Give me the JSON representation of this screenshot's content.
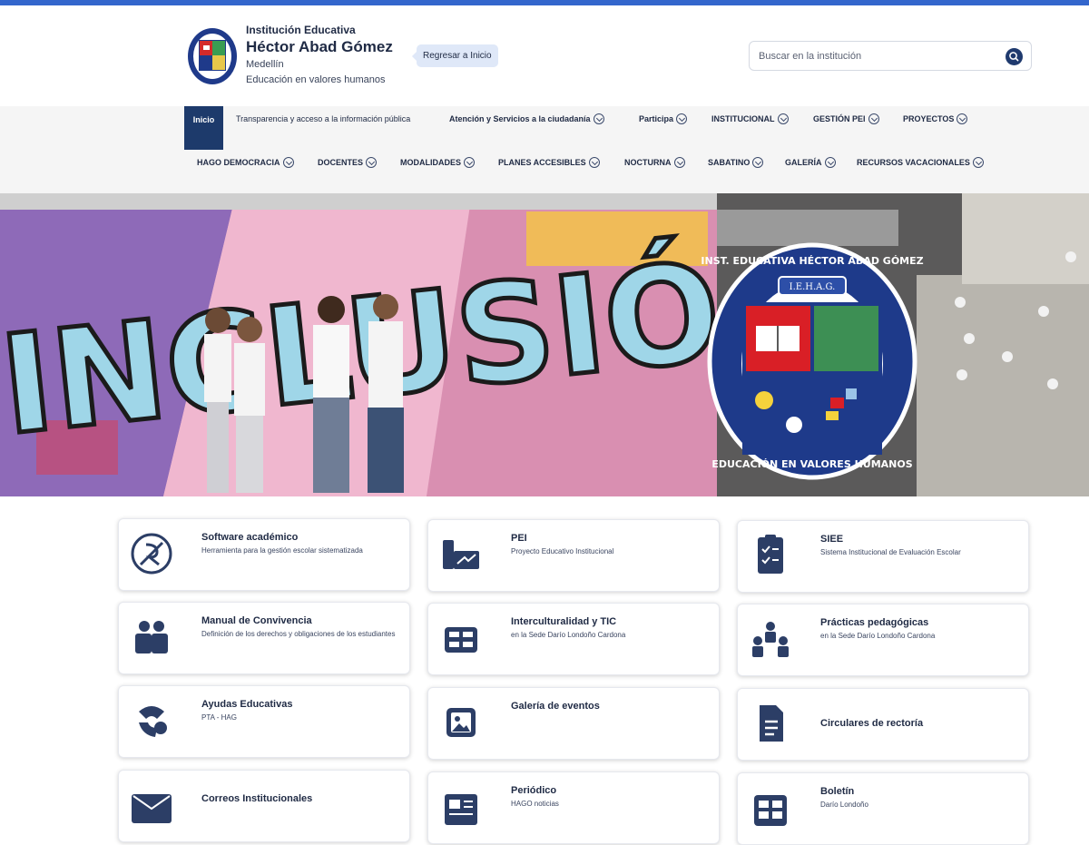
{
  "header": {
    "institution_type": "Institución Educativa",
    "institution_name": "Héctor Abad Gómez",
    "city": "Medellín",
    "motto": "Educación en valores humanos",
    "tooltip": "Regresar a Inicio",
    "search_placeholder": "Buscar en la institución"
  },
  "nav": {
    "row1": [
      {
        "label": "Inicio",
        "active": true
      },
      {
        "label": "Transparencia y acceso a la información pública"
      },
      {
        "label": "Atención y Servicios a la ciudadanía"
      },
      {
        "label": "Participa"
      },
      {
        "label": "INSTITUCIONAL"
      },
      {
        "label": "GESTIÓN PEI"
      },
      {
        "label": "PROYECTOS"
      }
    ],
    "row2": [
      {
        "label": "HAGO DEMOCRACIA"
      },
      {
        "label": "DOCENTES"
      },
      {
        "label": "MODALIDADES"
      },
      {
        "label": "PLANES ACCESIBLES"
      },
      {
        "label": "NOCTURNA"
      },
      {
        "label": "SABATINO"
      },
      {
        "label": "GALERÍA"
      },
      {
        "label": "RECURSOS VACACIONALES"
      }
    ]
  },
  "hero": {
    "mural_text": "INCLUSIÓN",
    "seal_top": "INST. EDUCATIVA HÉCTOR ABAD GÓMEZ",
    "seal_bottom": "EDUCACIÓN EN VALORES HUMANOS",
    "seal_badge": "I.E.H.A.G."
  },
  "cards": [
    {
      "title": "Software académico",
      "desc": "Herramienta para la gestión escolar sistematizada",
      "icon": "software-icon"
    },
    {
      "title": "PEI",
      "desc": "Proyecto Educativo Institucional",
      "icon": "pei-icon"
    },
    {
      "title": "SIEE",
      "desc": "Sistema Institucional de Evaluación Escolar",
      "icon": "checklist-icon"
    },
    {
      "title": "Manual de Convivencia",
      "desc": "Definición de los derechos y obligaciones de los estudiantes",
      "icon": "people-icon"
    },
    {
      "title": "Interculturalidad y TIC",
      "desc": "en la Sede Darío Londoño Cardona",
      "icon": "panels-icon"
    },
    {
      "title": "Prácticas pedagógicas",
      "desc": "en la Sede Darío Londoño Cardona",
      "icon": "group-icon"
    },
    {
      "title": "Ayudas Educativas",
      "desc": "PTA - HAG",
      "icon": "tools-icon"
    },
    {
      "title": "Galería de eventos",
      "desc": "",
      "icon": "gallery-icon"
    },
    {
      "title": "Circulares de rectoría",
      "desc": "",
      "icon": "document-icon"
    },
    {
      "title": "Correos Institucionales",
      "desc": "",
      "icon": "mail-icon"
    },
    {
      "title": "Periódico",
      "desc": "HAGO noticias",
      "icon": "newspaper-icon"
    },
    {
      "title": "Boletín",
      "desc": "Darío Londoño",
      "icon": "bulletin-icon"
    }
  ],
  "colors": {
    "primary": "#1d3a6b",
    "topbar": "#3366cc",
    "icon": "#2c3e66"
  }
}
